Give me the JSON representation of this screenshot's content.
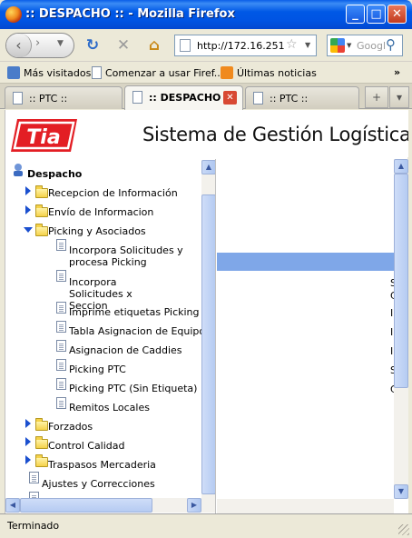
{
  "window": {
    "title": ":: DESPACHO :: - Mozilla Firefox"
  },
  "nav": {
    "url": "http://172.16.251",
    "search_placeholder": "Googl"
  },
  "bookmarks": [
    {
      "label": "Más visitados",
      "icon": "bookmark-icon"
    },
    {
      "label": "Comenzar a usar Firef...",
      "icon": "page-icon"
    },
    {
      "label": "Últimas noticias",
      "icon": "rss-icon"
    }
  ],
  "bookmarks_more": "»",
  "tabs": [
    {
      "label": ":: PTC ::",
      "active": false
    },
    {
      "label": ":: DESPACHO ::",
      "active": true
    },
    {
      "label": ":: PTC ::",
      "active": false
    }
  ],
  "header": {
    "logo_text": "TIA",
    "system_title": "Sistema de Gestión Logística"
  },
  "tree": {
    "root": "Despacho",
    "folders": [
      "Recepcion de Información",
      "Envío de Informacion",
      "Picking y Asociados"
    ],
    "picking_items": [
      "Incorpora Solicitudes y procesa Picking",
      "Incorpora Solicitudes x Seccion",
      "Imprime etiquetas Picking",
      "Tabla Asignacion de Equipos",
      "Asignacion de Caddies",
      "Picking PTC",
      "Picking PTC (Sin Etiqueta)",
      "Remitos Locales"
    ],
    "folders_after": [
      "Forzados",
      "Control Calidad",
      "Traspasos Mercaderia"
    ],
    "docs_after": [
      "Ajustes y Correcciones"
    ]
  },
  "status": {
    "text": "Terminado"
  }
}
